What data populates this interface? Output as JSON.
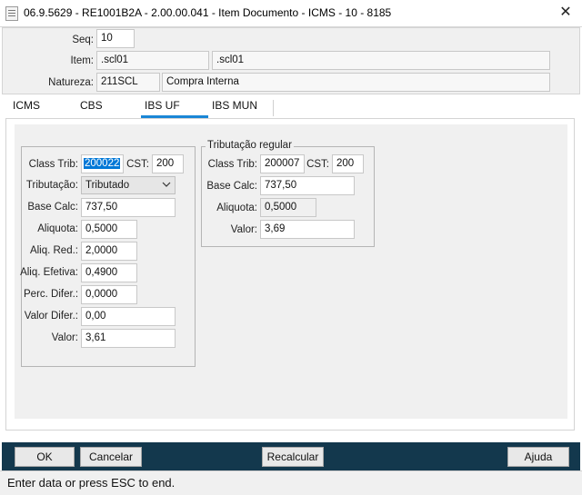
{
  "window": {
    "title": "06.9.5629 - RE1001B2A - 2.00.00.041 - Item Documento - ICMS - 10 - 8185",
    "close_glyph": "✕"
  },
  "header": {
    "seq_label": "Seq:",
    "seq_value": "10",
    "item_label": "Item:",
    "item_code": ".scl01",
    "item_desc": ".scl01",
    "natureza_label": "Natureza:",
    "natureza_code": "211SCL",
    "natureza_desc": "Compra Interna"
  },
  "tabs": [
    {
      "label": "ICMS"
    },
    {
      "label": "CBS"
    },
    {
      "label": "IBS UF",
      "active": true
    },
    {
      "label": "IBS MUN"
    }
  ],
  "left_group": {
    "class_trib_label": "Class Trib:",
    "class_trib_value": "200022",
    "cst_label": "CST:",
    "cst_value": "200",
    "tributacao_label": "Tributação:",
    "tributacao_value": "Tributado",
    "base_calc_label": "Base Calc:",
    "base_calc_value": "737,50",
    "aliquota_label": "Aliquota:",
    "aliquota_value": "0,5000",
    "aliq_red_label": "Aliq. Red.:",
    "aliq_red_value": "2,0000",
    "aliq_efetiva_label": "Aliq. Efetiva:",
    "aliq_efetiva_value": "0,4900",
    "perc_difer_label": "Perc. Difer.:",
    "perc_difer_value": "0,0000",
    "valor_difer_label": "Valor Difer.:",
    "valor_difer_value": "0,00",
    "valor_label": "Valor:",
    "valor_value": "3,61"
  },
  "right_group": {
    "title": "Tributação regular",
    "class_trib_label": "Class Trib:",
    "class_trib_value": "200007",
    "cst_label": "CST:",
    "cst_value": "200",
    "base_calc_label": "Base Calc:",
    "base_calc_value": "737,50",
    "aliquota_label": "Aliquota:",
    "aliquota_value": "0,5000",
    "valor_label": "Valor:",
    "valor_value": "3,69"
  },
  "buttons": {
    "ok": "OK",
    "cancelar": "Cancelar",
    "recalcular": "Recalcular",
    "ajuda": "Ajuda"
  },
  "status_bar": {
    "text": "Enter data or press ESC to end."
  },
  "colors": {
    "footer_bar": "#13384d",
    "tab_accent": "#1a86d6",
    "selection": "#0078d7"
  }
}
